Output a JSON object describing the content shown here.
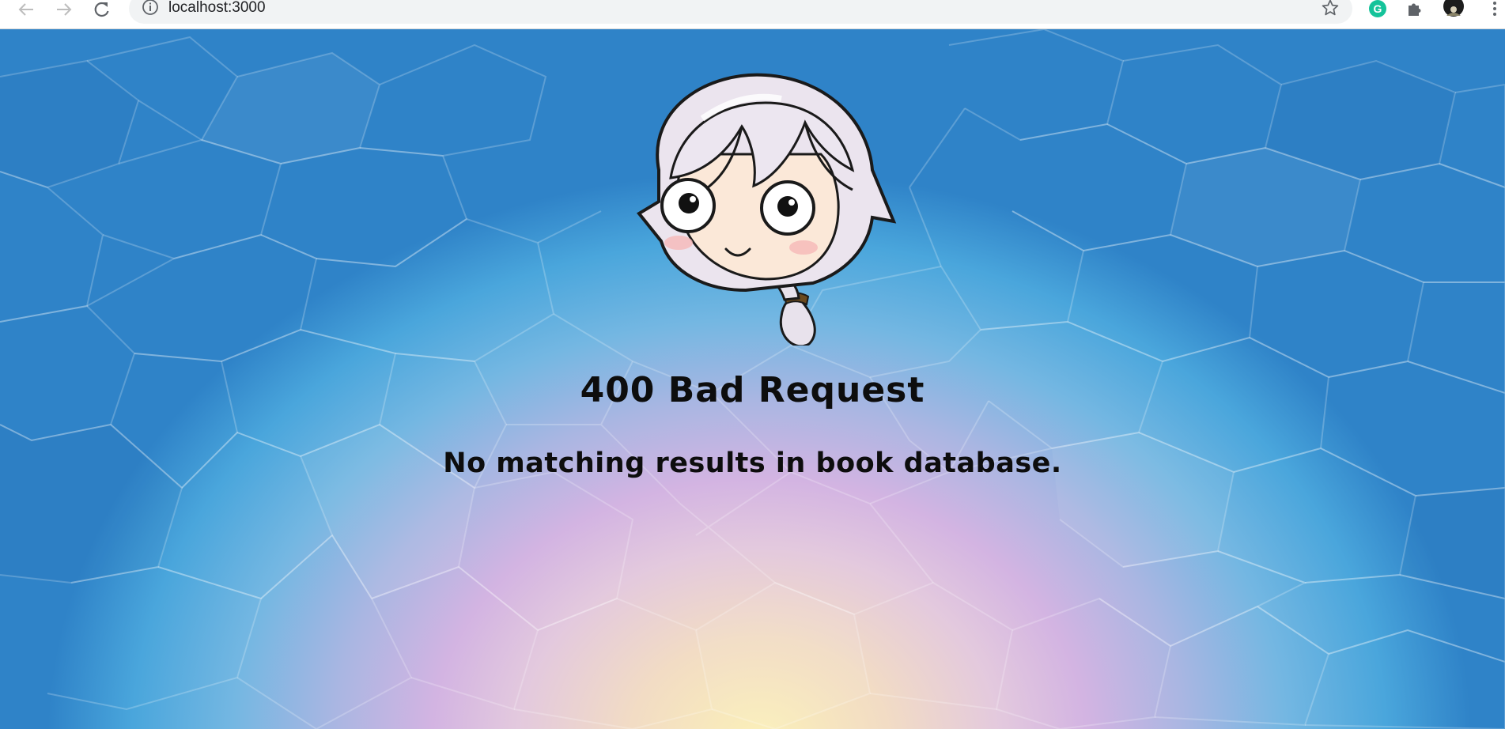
{
  "browser": {
    "url": "localhost:3000",
    "buttons": {
      "back_icon": "back-arrow-icon",
      "forward_icon": "forward-arrow-icon",
      "reload_icon": "reload-icon",
      "site_info_icon": "info-icon",
      "bookmark_icon": "star-icon",
      "grammarly_icon": "grammarly-icon",
      "extensions_icon": "puzzle-icon",
      "profile_icon": "avatar-icon",
      "menu_icon": "kebab-menu-icon"
    },
    "colors": {
      "toolbar_bg": "#ffffff",
      "omnibox_bg": "#f1f3f4",
      "grammarly": "#15c39a"
    }
  },
  "page": {
    "title": "400 Bad Request",
    "message": "No matching results in book database.",
    "mascot_icon": "chibi-mascot-illustration",
    "colors": {
      "text": "#0d0d0d",
      "bg_outer": "#2f83c8",
      "bg_mid": "#d3b4e2",
      "bg_center": "#fbf0b8"
    }
  }
}
